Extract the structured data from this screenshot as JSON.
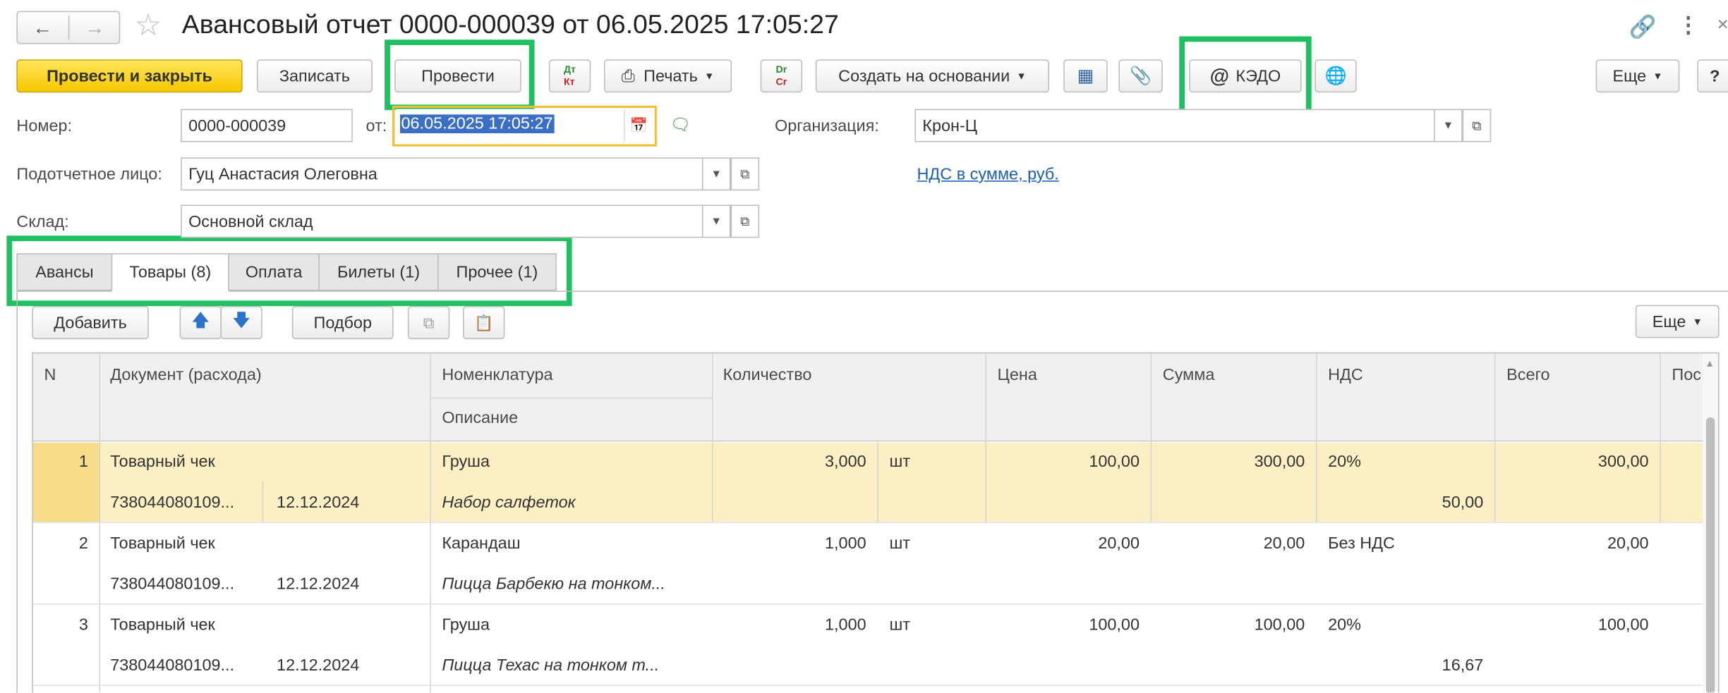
{
  "window": {
    "title": "Авансовый отчет 0000-000039 от 06.05.2025 17:05:27"
  },
  "toolbar": {
    "post_close": "Провести и закрыть",
    "save": "Записать",
    "post": "Провести",
    "print": "Печать",
    "create_based": "Создать на основании",
    "kedo": "КЭДО",
    "more": "Еще",
    "help": "?",
    "dtkt_top": "Дт",
    "dtkt_bottom": "Кт",
    "drcr_top": "Dr",
    "drcr_bottom": "Cr"
  },
  "form": {
    "number_label": "Номер:",
    "number_value": "0000-000039",
    "date_label": "от:",
    "date_value": "06.05.2025 17:05:27",
    "org_label": "Организация:",
    "org_value": "Крон-Ц",
    "person_label": "Подотчетное лицо:",
    "person_value": "Гуц Анастасия Олеговна",
    "vat_link": "НДС в сумме, руб.",
    "warehouse_label": "Склад:",
    "warehouse_value": "Основной склад"
  },
  "tabs": [
    {
      "label": "Авансы"
    },
    {
      "label": "Товары (8)"
    },
    {
      "label": "Оплата"
    },
    {
      "label": "Билеты (1)"
    },
    {
      "label": "Прочее (1)"
    }
  ],
  "table_toolbar": {
    "add": "Добавить",
    "pick": "Подбор",
    "more": "Еще"
  },
  "table": {
    "headers": {
      "n": "N",
      "doc": "Документ (расхода)",
      "item": "Номенклатура",
      "desc": "Описание",
      "qty": "Количество",
      "price": "Цена",
      "sum": "Сумма",
      "vat": "НДС",
      "total": "Всего",
      "pos": "Пос"
    },
    "rows": [
      {
        "n": "1",
        "doc": "Товарный чек",
        "doc_num": "738044080109...",
        "doc_date": "12.12.2024",
        "item": "Груша",
        "desc": "Набор салфеток",
        "qty": "3,000",
        "unit": "шт",
        "price": "100,00",
        "sum": "300,00",
        "vat_rate": "20%",
        "vat_sum": "50,00",
        "total": "300,00"
      },
      {
        "n": "2",
        "doc": "Товарный чек",
        "doc_num": "738044080109...",
        "doc_date": "12.12.2024",
        "item": "Карандаш",
        "desc": "Пицца  Барбекю  на тонком...",
        "qty": "1,000",
        "unit": "шт",
        "price": "20,00",
        "sum": "20,00",
        "vat_rate": "Без НДС",
        "vat_sum": "",
        "total": "20,00"
      },
      {
        "n": "3",
        "doc": "Товарный чек",
        "doc_num": "738044080109...",
        "doc_date": "12.12.2024",
        "item": "Груша",
        "desc": "Пицца  Техас  на тонком т...",
        "qty": "1,000",
        "unit": "шт",
        "price": "100,00",
        "sum": "100,00",
        "vat_rate": "20%",
        "vat_sum": "16,67",
        "total": "100,00"
      }
    ]
  }
}
